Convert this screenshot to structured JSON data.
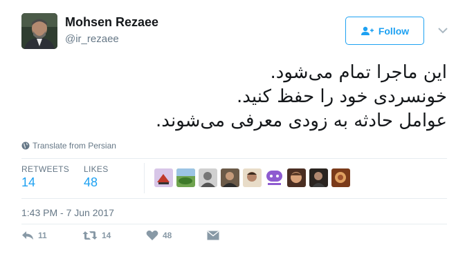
{
  "author": {
    "name": "Mohsen Rezaee",
    "handle": "@ir_rezaee"
  },
  "follow_button": {
    "label": "Follow"
  },
  "tweet": {
    "lines": [
      "این ماجرا تمام می‌شود.",
      "خونسردی خود را حفظ کنید.",
      "عوامل حادثه به زودی معرفی می‌شوند."
    ],
    "translate_label": "Translate from Persian"
  },
  "stats": {
    "retweets_label": "RETWEETS",
    "retweets_value": "14",
    "likes_label": "LIKES",
    "likes_value": "48"
  },
  "likers": [
    {
      "name": "liker-avatar-1",
      "color": "#c9a6d8"
    },
    {
      "name": "liker-avatar-2",
      "color": "#4f8a3c"
    },
    {
      "name": "liker-avatar-3",
      "color": "#8a8a8a"
    },
    {
      "name": "liker-avatar-4",
      "color": "#5a4a3a"
    },
    {
      "name": "liker-avatar-5",
      "color": "#b08a6a"
    },
    {
      "name": "liker-avatar-6",
      "color": "#8e5bd0"
    },
    {
      "name": "liker-avatar-7",
      "color": "#c8946a"
    },
    {
      "name": "liker-avatar-8",
      "color": "#3a3026"
    },
    {
      "name": "liker-avatar-9",
      "color": "#a0522d"
    }
  ],
  "timestamp": "1:43 PM - 7 Jun 2017",
  "actions": {
    "reply_count": "11",
    "retweet_count": "14",
    "like_count": "48"
  },
  "colors": {
    "accent": "#1da1f2",
    "muted": "#657786",
    "icon": "#8899a6"
  }
}
